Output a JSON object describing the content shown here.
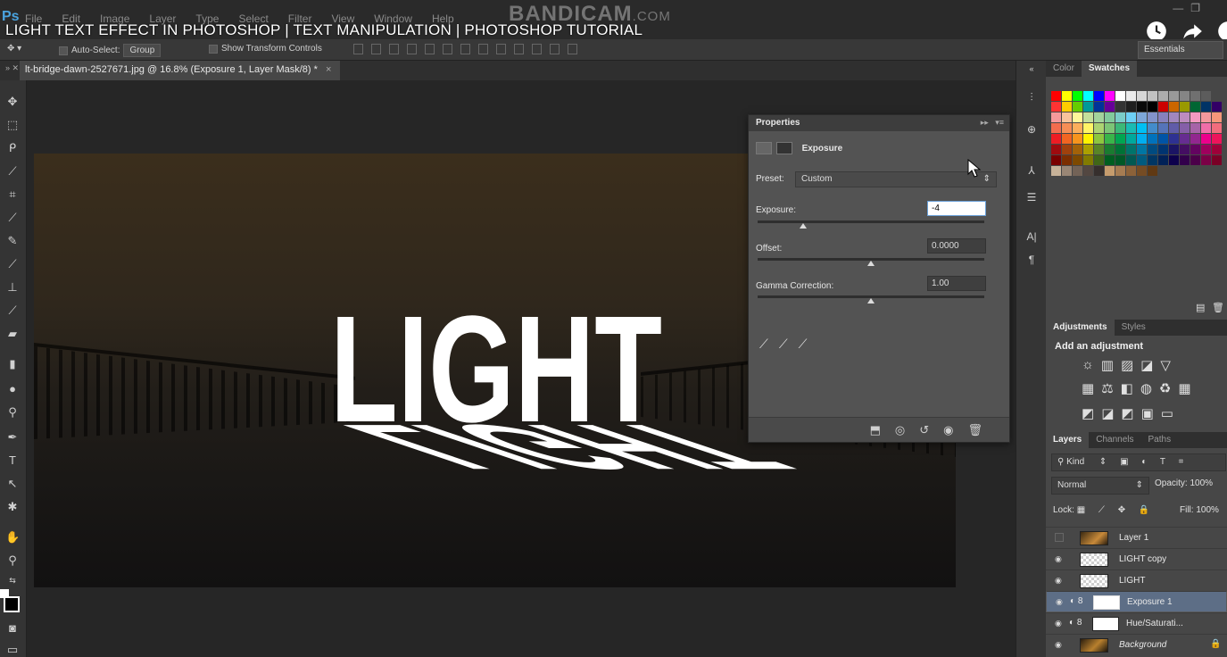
{
  "video": {
    "title": "LIGHT TEXT EFFECT IN PHOTOSHOP | TEXT MANIPULATION | PHOTOSHOP TUTORIAL",
    "watermark": "BANDICAM",
    "watermark_suffix": ".COM"
  },
  "menubar": {
    "logo": "Ps",
    "items": [
      "File",
      "Edit",
      "Image",
      "Layer",
      "Type",
      "Select",
      "Filter",
      "View",
      "Window",
      "Help"
    ]
  },
  "options": {
    "auto_select_label": "Auto-Select:",
    "auto_select_value": "Group",
    "show_transform_label": "Show Transform Controls",
    "workspace": "Essentials"
  },
  "document": {
    "tab_title": "lt-bridge-dawn-2527671.jpg @ 16.8% (Exposure 1, Layer Mask/8) *",
    "close": "×"
  },
  "canvas_text": "LIGHT",
  "properties": {
    "panel_title": "Properties",
    "adjustment": "Exposure",
    "preset_label": "Preset:",
    "preset_value": "Custom",
    "exposure_label": "Exposure:",
    "exposure_value": "-4",
    "exposure_fraction": 0.2,
    "offset_label": "Offset:",
    "offset_value": "0.0000",
    "offset_fraction": 0.5,
    "gamma_label": "Gamma Correction:",
    "gamma_value": "1.00",
    "gamma_fraction": 0.5
  },
  "color_panel": {
    "tabs": [
      "Color",
      "Swatches"
    ],
    "active_tab": "Swatches"
  },
  "adjustments_panel": {
    "tabs": [
      "Adjustments",
      "Styles"
    ],
    "title": "Add an adjustment"
  },
  "layers_panel": {
    "tabs": [
      "Layers",
      "Channels",
      "Paths"
    ],
    "filter_label": "Kind",
    "blend_mode": "Normal",
    "opacity_label": "Opacity:",
    "opacity_value": "100%",
    "lock_label": "Lock:",
    "fill_label": "Fill:",
    "fill_value": "100%",
    "layers": [
      {
        "name": "Layer 1",
        "visible": false,
        "thumb": "photo"
      },
      {
        "name": "LIGHT copy",
        "visible": true,
        "thumb": "checker"
      },
      {
        "name": "LIGHT",
        "visible": true,
        "thumb": "checker"
      },
      {
        "name": "Exposure 1",
        "visible": true,
        "thumb": "mask",
        "selected": true
      },
      {
        "name": "Hue/Saturati...",
        "visible": true,
        "thumb": "mask"
      },
      {
        "name": "Background",
        "visible": true,
        "thumb": "photo"
      }
    ]
  },
  "colors": {
    "accent": "#4aa3df",
    "selected_layer": "#5d6e86",
    "panel_bg": "#535353"
  }
}
